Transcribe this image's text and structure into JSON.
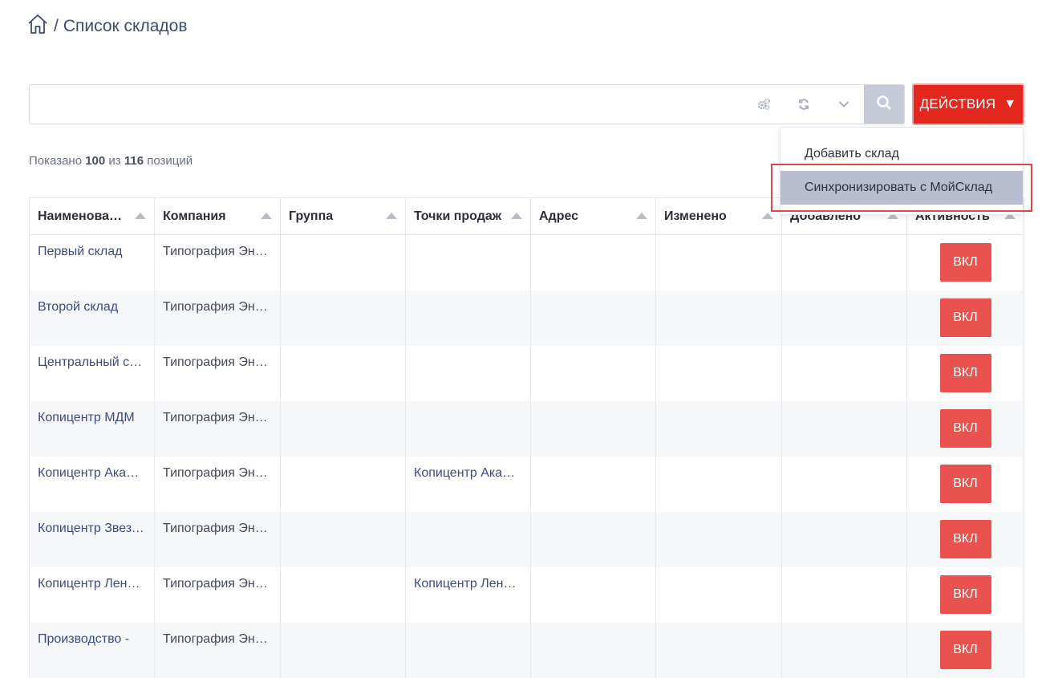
{
  "breadcrumb": {
    "separator": "/",
    "title": "Список складов"
  },
  "search": {
    "placeholder": ""
  },
  "actions": {
    "label": "ДЕЙСТВИЯ",
    "arrow": "▼"
  },
  "dropdown": {
    "items": [
      "Добавить склад",
      "Синхронизировать с МойСклад"
    ]
  },
  "summary": {
    "prefix": "Показано",
    "shown": "100",
    "mid": "из",
    "total": "116",
    "suffix": "позиций"
  },
  "columns": [
    "Наименование",
    "Компания",
    "Группа",
    "Точки продаж",
    "Адрес",
    "Изменено",
    "Добавлено",
    "Активность"
  ],
  "rows": [
    {
      "name": "Первый склад",
      "company": "Типография Энтер",
      "group": "",
      "points": "",
      "address": "",
      "changed": "",
      "added": "",
      "status": "ВКЛ"
    },
    {
      "name": "Второй склад",
      "company": "Типография Энтер",
      "group": "",
      "points": "",
      "address": "",
      "changed": "",
      "added": "",
      "status": "ВКЛ"
    },
    {
      "name": "Центральный склад",
      "company": "Типография Энтер",
      "group": "",
      "points": "",
      "address": "",
      "changed": "",
      "added": "",
      "status": "ВКЛ"
    },
    {
      "name": "Копицентр МДМ",
      "company": "Типография Энтер",
      "group": "",
      "points": "",
      "address": "",
      "changed": "",
      "added": "",
      "status": "ВКЛ"
    },
    {
      "name": "Копицентр Академическая",
      "company": "Типография Энтер",
      "group": "",
      "points": "Копицентр Академическая",
      "address": "",
      "changed": "",
      "added": "",
      "status": "ВКЛ"
    },
    {
      "name": "Копицентр Звездная",
      "company": "Типография Энтер",
      "group": "",
      "points": "",
      "address": "",
      "changed": "",
      "added": "",
      "status": "ВКЛ"
    },
    {
      "name": "Копицентр Ленинский",
      "company": "Типография Энтер",
      "group": "",
      "points": "Копицентр Ленинский",
      "address": "",
      "changed": "",
      "added": "",
      "status": "ВКЛ"
    },
    {
      "name": "Производство - ",
      "company": "Типография Энтер",
      "group": "",
      "points": "",
      "address": "",
      "changed": "",
      "added": "",
      "status": "ВКЛ"
    }
  ],
  "colors": {
    "accent": "#e3271e",
    "status_on": "#e9524e",
    "link": "#3b4a85",
    "menu_hover": "#b8bdd0"
  },
  "icons": {
    "home": "home-icon",
    "settings": "gears-icon",
    "refresh": "refresh-icon",
    "expand": "chevron-down-icon",
    "search": "search-icon"
  }
}
